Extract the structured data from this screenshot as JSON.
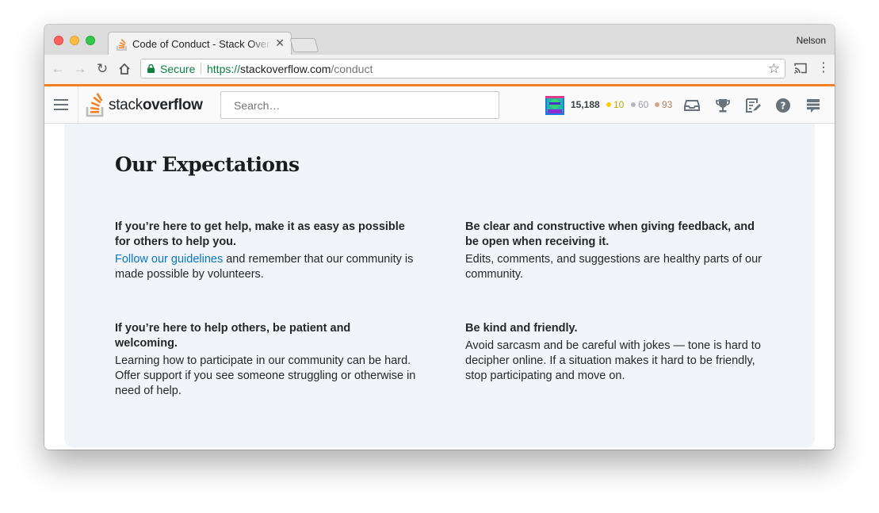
{
  "browser": {
    "tab_title": "Code of Conduct - Stack Overflow",
    "profile_name": "Nelson",
    "secure_label": "Secure",
    "url_scheme": "https://",
    "url_host": "stackoverflow.com",
    "url_path": "/conduct"
  },
  "header": {
    "logo_light": "stack",
    "logo_bold": "overflow",
    "search_placeholder": "Search…",
    "reputation": "15,188",
    "gold_badges": "10",
    "silver_badges": "60",
    "bronze_badges": "93"
  },
  "content": {
    "heading": "Our Expectations",
    "items": [
      {
        "title": "If you’re here to get help, make it as easy as possible for others to help you.",
        "link": "Follow our guidelines",
        "body": " and remember that our community is made possible by volunteers."
      },
      {
        "title": "Be clear and constructive when giving feedback, and be open when receiving it.",
        "body": "Edits, comments, and suggestions are healthy parts of our community."
      },
      {
        "title": "If you’re here to help others, be patient and welcoming.",
        "body": "Learning how to participate in our community can be hard. Offer support if you see someone struggling or otherwise in need of help."
      },
      {
        "title": "Be kind and friendly.",
        "body": "Avoid sarcasm and be careful with jokes — tone is hard to decipher online. If a situation makes it hard to be friendly, stop participating and move on."
      }
    ]
  },
  "colors": {
    "accent": "#f48024",
    "link": "#0a74c6",
    "secure_green": "#0b8043",
    "card_bg": "#f1f5f9"
  }
}
